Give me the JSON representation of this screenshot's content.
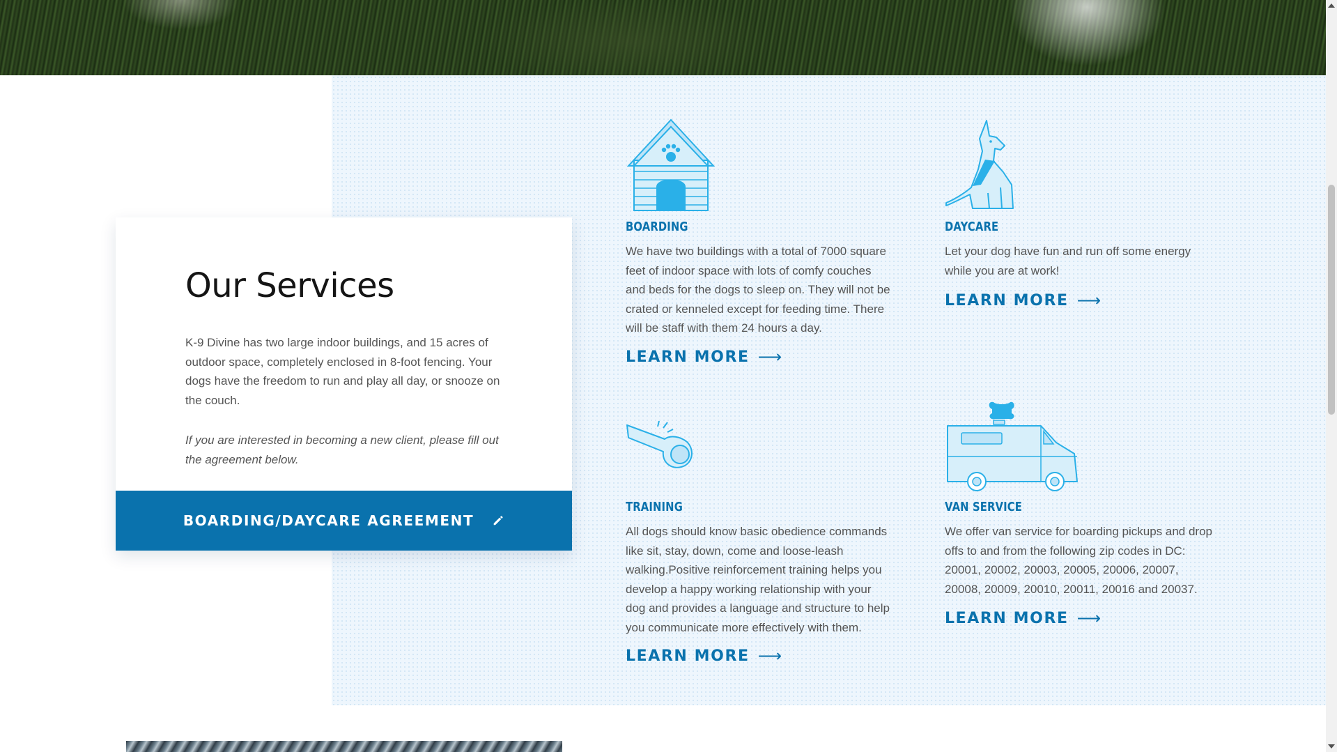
{
  "intro": {
    "title": "Our Services",
    "text": "K-9 Divine has two large indoor buildings, and 15 acres of outdoor space, completely enclosed in 8-foot fencing. Your dogs have the freedom to run and play all day, or snooze on the couch.",
    "note": "If you are interested in becoming a new client, please fill out the agreement below.",
    "button_label": "BOARDING/DAYCARE AGREEMENT",
    "button_icon": "pencil-icon"
  },
  "services": [
    {
      "title": "BOARDING",
      "icon": "doghouse-icon",
      "text": "We have two buildings with a total of 7000 square feet of indoor space with lots of comfy couches and beds for the dogs to sleep on. They will not be crated or kenneled except for feeding time. There will be staff with them 24 hours a day.",
      "link": "LEARN MORE"
    },
    {
      "title": "DAYCARE",
      "icon": "sitting-dog-icon",
      "text": "Let your dog have fun and run off some energy while you are at work!",
      "link": "LEARN MORE"
    },
    {
      "title": "TRAINING",
      "icon": "whistle-icon",
      "text": "All dogs should know basic obedience commands like sit, stay, down, come and loose-leash walking.Positive reinforcement training helps you develop a happy working relationship with your dog and provides a language and structure to help you communicate more effectively with them.",
      "link": "LEARN MORE"
    },
    {
      "title": "VAN SERVICE",
      "icon": "van-icon",
      "text": "We offer van service for boarding pickups and drop offs to and from the following zip codes in DC: 20001, 20002, 20003, 20005, 20006, 20007, 20008, 20009, 20010, 20011, 20016 and 20037.",
      "link": "LEARN MORE"
    }
  ],
  "arrow_glyph": "⟶",
  "colors": {
    "accent": "#0a72ad",
    "icon_light": "#bfe4f7",
    "icon_line": "#2ab0e8",
    "band": "#eef6fd"
  }
}
